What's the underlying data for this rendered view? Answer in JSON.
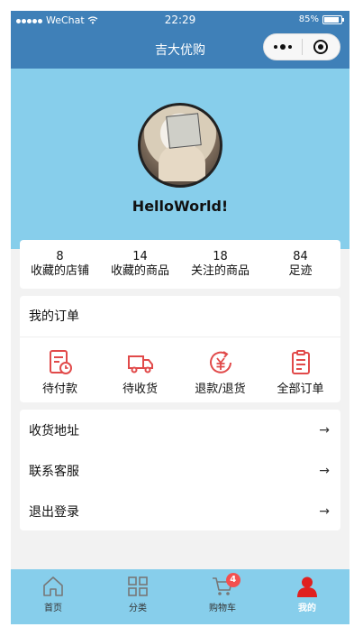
{
  "status_bar": {
    "carrier": "WeChat",
    "time": "22:29",
    "battery": "85%"
  },
  "nav": {
    "title": "吉大优购"
  },
  "profile": {
    "username": "HelloWorld!"
  },
  "stats": [
    {
      "value": "8",
      "label": "收藏的店铺"
    },
    {
      "value": "14",
      "label": "收藏的商品"
    },
    {
      "value": "18",
      "label": "关注的商品"
    },
    {
      "value": "84",
      "label": "足迹"
    }
  ],
  "orders": {
    "title": "我的订单",
    "items": [
      {
        "label": "待付款",
        "icon": "pending-payment-icon"
      },
      {
        "label": "待收货",
        "icon": "truck-icon"
      },
      {
        "label": "退款/退货",
        "icon": "refund-icon"
      },
      {
        "label": "全部订单",
        "icon": "clipboard-icon"
      }
    ]
  },
  "menu": [
    {
      "label": "收货地址",
      "arrow": "→"
    },
    {
      "label": "联系客服",
      "arrow": "→"
    },
    {
      "label": "退出登录",
      "arrow": "→"
    }
  ],
  "tabbar": [
    {
      "label": "首页",
      "icon": "home-icon"
    },
    {
      "label": "分类",
      "icon": "grid-icon"
    },
    {
      "label": "购物车",
      "icon": "cart-icon",
      "badge": "4"
    },
    {
      "label": "我的",
      "icon": "user-icon",
      "active": true
    }
  ],
  "colors": {
    "nav_bg": "#3f80b8",
    "header_bg": "#87ceeb",
    "accent": "#e14a4a",
    "badge": "#f45050"
  }
}
